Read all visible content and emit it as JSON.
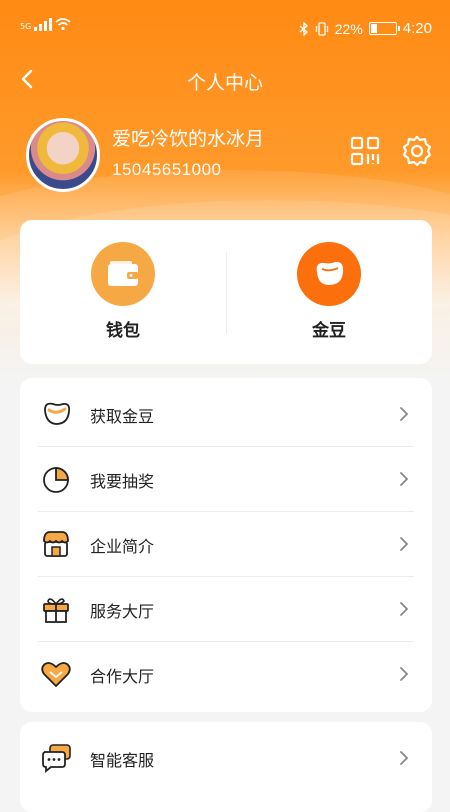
{
  "status_bar": {
    "network": "5G",
    "battery": "22%",
    "time": "4:20"
  },
  "nav": {
    "title": "个人中心"
  },
  "profile": {
    "name": "爱吃冷饮的水冰月",
    "phone": "15045651000"
  },
  "quick_actions": [
    {
      "label": "钱包",
      "icon": "wallet-icon"
    },
    {
      "label": "金豆",
      "icon": "bean-icon"
    }
  ],
  "menu": [
    {
      "label": "获取金豆",
      "icon": "bean-outline-icon"
    },
    {
      "label": "我要抽奖",
      "icon": "pie-chart-icon"
    },
    {
      "label": "企业简介",
      "icon": "shop-icon"
    },
    {
      "label": "服务大厅",
      "icon": "gift-icon"
    },
    {
      "label": "合作大厅",
      "icon": "heart-hands-icon"
    }
  ],
  "menu2": [
    {
      "label": "智能客服",
      "icon": "chat-bubble-icon"
    }
  ],
  "colors": {
    "accent": "#ff8a14",
    "accent_light": "#f6a845"
  }
}
